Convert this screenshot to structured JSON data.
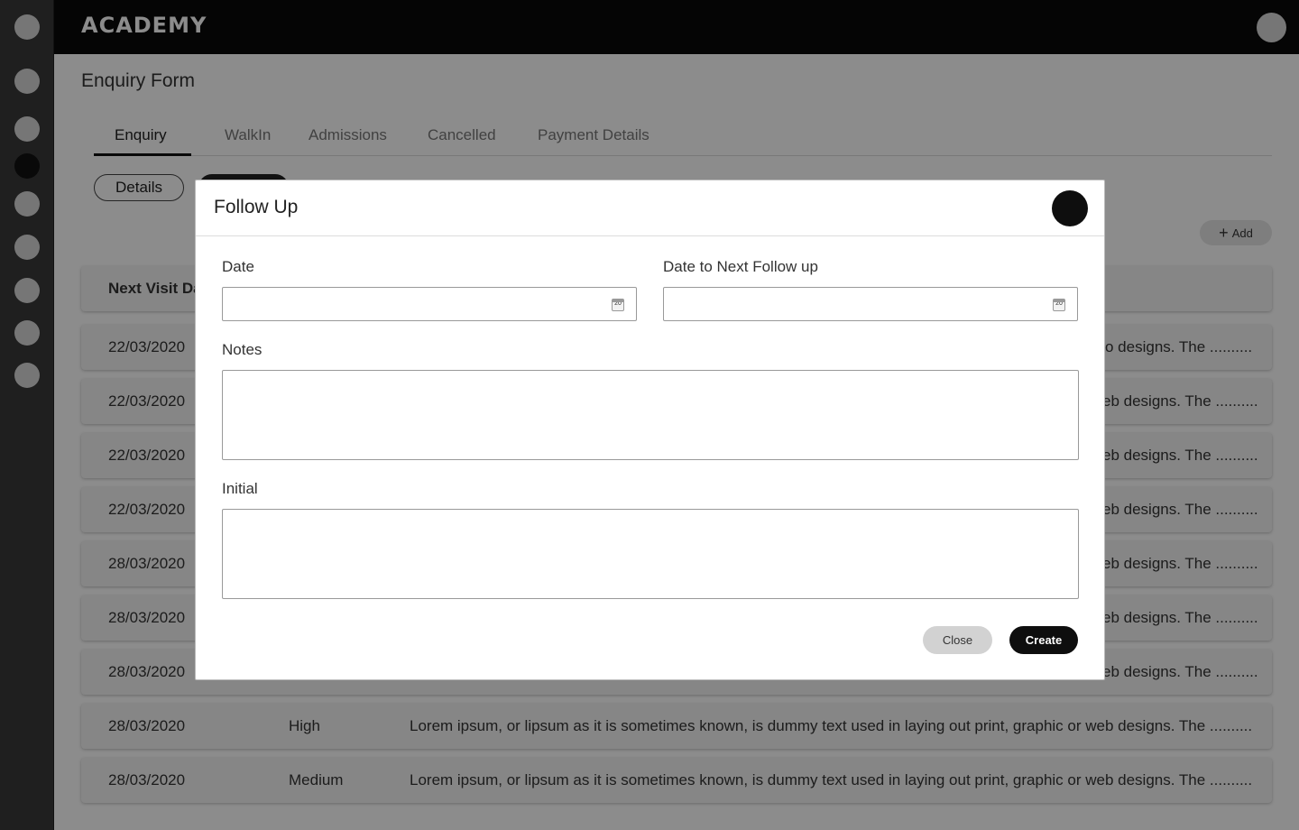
{
  "app": {
    "brand": "ACADEMY"
  },
  "sidebar": {
    "active_index": 3
  },
  "page": {
    "title": "Enquiry Form"
  },
  "tabs": [
    {
      "label": "Enquiry",
      "active": true
    },
    {
      "label": "WalkIn",
      "active": false
    },
    {
      "label": "Admissions",
      "active": false
    },
    {
      "label": "Cancelled",
      "active": false
    },
    {
      "label": "Payment Details",
      "active": false
    }
  ],
  "subtabs": {
    "details_label": "Details"
  },
  "toolbar": {
    "add_label": "Add"
  },
  "table": {
    "header": {
      "next_visit_date": "Next Visit Da"
    },
    "rows": [
      {
        "date": "22/03/2020",
        "priority": "",
        "note": "o designs. The .........."
      },
      {
        "date": "22/03/2020",
        "priority": "",
        "note": "eb designs. The .........."
      },
      {
        "date": "22/03/2020",
        "priority": "",
        "note": "eb designs. The .........."
      },
      {
        "date": "22/03/2020",
        "priority": "",
        "note": "eb designs. The .........."
      },
      {
        "date": "28/03/2020",
        "priority": "",
        "note": "eb designs. The .........."
      },
      {
        "date": "28/03/2020",
        "priority": "",
        "note": "eb designs. The .........."
      },
      {
        "date": "28/03/2020",
        "priority": "",
        "note": "eb designs. The .........."
      },
      {
        "date": "28/03/2020",
        "priority": "High",
        "note": "Lorem ipsum, or lipsum as it is sometimes known, is dummy text used in laying out print, graphic or web designs. The .........."
      },
      {
        "date": "28/03/2020",
        "priority": "Medium",
        "note": "Lorem ipsum, or lipsum as it is sometimes known, is dummy text used in laying out print, graphic or web designs. The .........."
      }
    ]
  },
  "modal": {
    "title": "Follow Up",
    "date_label": "Date",
    "next_date_label": "Date to Next Follow up",
    "calendar_icon_text": "20",
    "notes_label": "Notes",
    "initial_label": "Initial",
    "close_label": "Close",
    "create_label": "Create"
  },
  "colors": {
    "overlay": "#00000073",
    "primary": "#0e0e0e",
    "sidebar": "#3a3a3a"
  }
}
